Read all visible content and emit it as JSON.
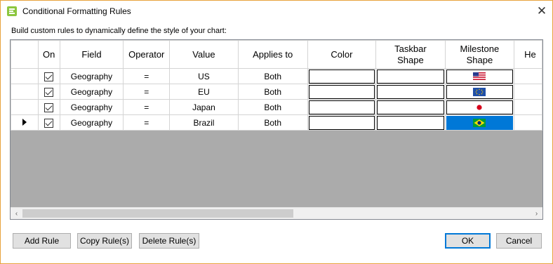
{
  "window": {
    "title": "Conditional Formatting Rules",
    "close_glyph": "✕"
  },
  "instruction": "Build custom rules to dynamically define the style of your chart:",
  "grid": {
    "columns": {
      "on": "On",
      "field": "Field",
      "operator": "Operator",
      "value": "Value",
      "applies_to": "Applies to",
      "color": "Color",
      "taskbar_shape_l1": "Taskbar",
      "taskbar_shape_l2": "Shape",
      "milestone_shape_l1": "Milestone",
      "milestone_shape_l2": "Shape",
      "partial": "He"
    },
    "rows": [
      {
        "on": true,
        "field": "Geography",
        "operator": "=",
        "value": "US",
        "applies_to": "Both",
        "milestone_icon": "us-flag-icon"
      },
      {
        "on": true,
        "field": "Geography",
        "operator": "=",
        "value": "EU",
        "applies_to": "Both",
        "milestone_icon": "eu-flag-icon"
      },
      {
        "on": true,
        "field": "Geography",
        "operator": "=",
        "value": "Japan",
        "applies_to": "Both",
        "milestone_icon": "japan-flag-icon"
      },
      {
        "on": true,
        "field": "Geography",
        "operator": "=",
        "value": "Brazil",
        "applies_to": "Both",
        "milestone_icon": "brazil-flag-icon",
        "current": true,
        "selected_cell": "milestone_shape"
      }
    ]
  },
  "buttons": {
    "add_rule": "Add Rule",
    "copy_rules": "Copy Rule(s)",
    "delete_rules": "Delete Rule(s)",
    "ok": "OK",
    "cancel": "Cancel"
  },
  "colors": {
    "window_border": "#e8a33d",
    "selection": "#0078d7",
    "grid_empty_area": "#ababab"
  }
}
